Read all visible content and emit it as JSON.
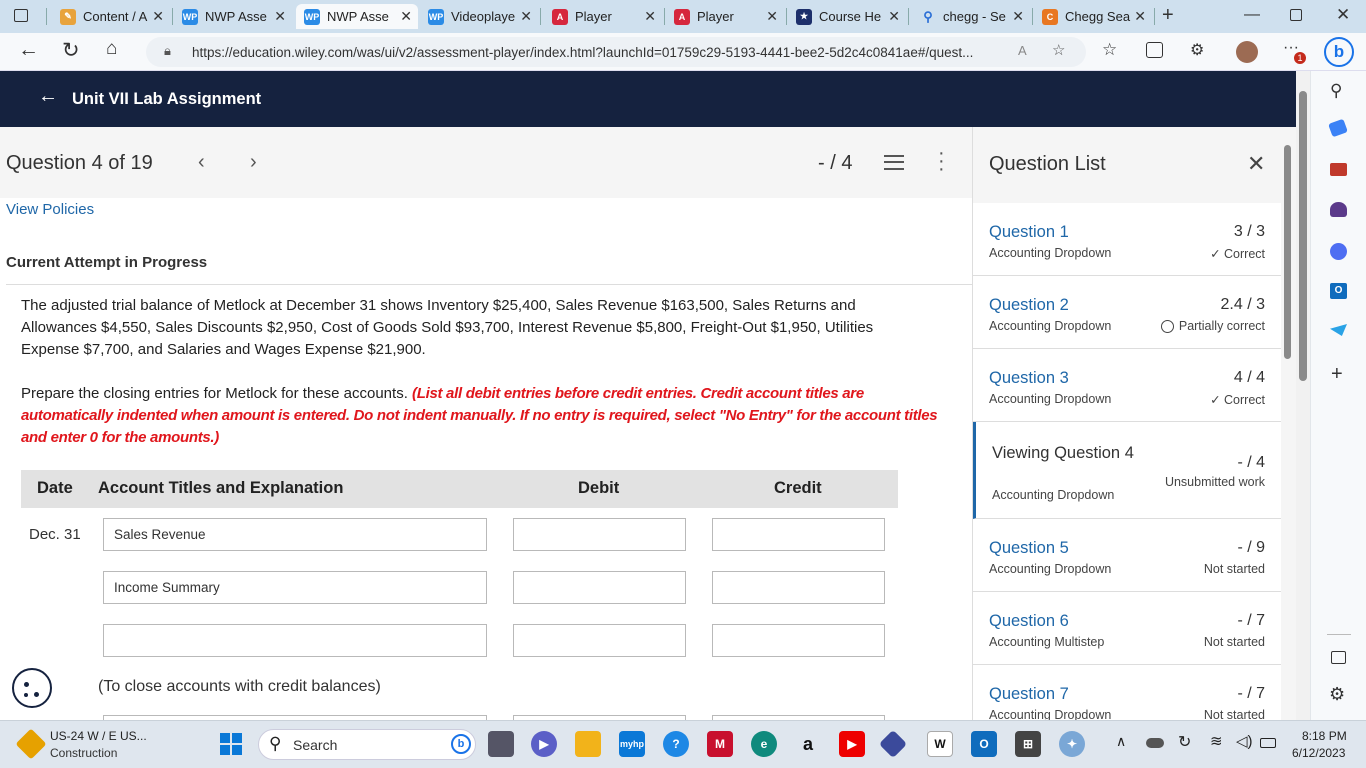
{
  "browser": {
    "tabs": [
      {
        "label": "Content / A",
        "icon": "pencil-icon",
        "color": "#e8a33c"
      },
      {
        "label": "NWP Asse",
        "icon": "wp-icon",
        "color": "#2b8be6"
      },
      {
        "label": "NWP Asse",
        "icon": "wp-icon",
        "color": "#2b8be6",
        "active": true
      },
      {
        "label": "Videoplaye",
        "icon": "wp-icon",
        "color": "#2b8be6"
      },
      {
        "label": "Player",
        "icon": "angular-icon",
        "color": "#d6273d"
      },
      {
        "label": "Player",
        "icon": "angular-icon",
        "color": "#d6273d"
      },
      {
        "label": "Course He",
        "icon": "star-icon",
        "color": "#1d2f6b"
      },
      {
        "label": "chegg - Se",
        "icon": "search-icon",
        "color": "#2b6fd6"
      },
      {
        "label": "Chegg Sea",
        "icon": "chegg-icon",
        "color": "#e87722"
      }
    ],
    "url": "https://education.wiley.com/was/ui/v2/assessment-player/index.html?launchId=01759c29-5193-4441-bee2-5d2c4c0841ae#/quest...",
    "notif_badge": "1"
  },
  "app": {
    "back_title": "Unit VII Lab Assignment",
    "question_nav": {
      "label": "Question 4 of 19",
      "score": "- / 4"
    },
    "view_policies": "View Policies",
    "attempt_status": "Current Attempt in Progress",
    "problem_text": "The adjusted trial balance of Metlock at December 31 shows Inventory $25,400, Sales Revenue $163,500, Sales Returns and Allowances $4,550, Sales Discounts $2,950, Cost of Goods Sold $93,700, Interest Revenue $5,800, Freight-Out $1,950, Utilities Expense $7,700, and Salaries and Wages Expense $21,900.",
    "instruction_lead": "Prepare the closing entries for Metlock for these accounts.",
    "instruction_red": "(List all debit entries before credit entries. Credit account titles are automatically indented when amount is entered. Do not indent manually. If no entry is required, select \"No Entry\" for the account titles and enter 0 for the amounts.)",
    "table": {
      "headers": [
        "Date",
        "Account Titles and Explanation",
        "Debit",
        "Credit"
      ],
      "date": "Dec. 31",
      "rows": [
        {
          "account": "Sales Revenue",
          "debit": "",
          "credit": ""
        },
        {
          "account": "Income Summary",
          "debit": "",
          "credit": ""
        },
        {
          "account": "",
          "debit": "",
          "credit": ""
        }
      ],
      "explanation": "(To close accounts with credit balances)"
    }
  },
  "question_list": {
    "title": "Question List",
    "items": [
      {
        "title": "Question 1",
        "type": "Accounting Dropdown",
        "score": "3 / 3",
        "status": "✓ Correct"
      },
      {
        "title": "Question 2",
        "type": "Accounting Dropdown",
        "score": "2.4 / 3",
        "status": "Partially correct"
      },
      {
        "title": "Question 3",
        "type": "Accounting Dropdown",
        "score": "4 / 4",
        "status": "✓ Correct"
      },
      {
        "title": "Viewing Question 4",
        "type": "Accounting Dropdown",
        "score": "- / 4",
        "status": "Unsubmitted work",
        "current": true
      },
      {
        "title": "Question 5",
        "type": "Accounting Dropdown",
        "score": "- / 9",
        "status": "Not started"
      },
      {
        "title": "Question 6",
        "type": "Accounting Multistep",
        "score": "- / 7",
        "status": "Not started"
      },
      {
        "title": "Question 7",
        "type": "Accounting Dropdown",
        "score": "- / 7",
        "status": "Not started"
      }
    ]
  },
  "taskbar": {
    "weather_title": "US-24 W / E US...",
    "weather_sub": "Construction",
    "search_placeholder": "Search",
    "time": "8:18 PM",
    "date": "6/12/2023"
  },
  "colors": {
    "header_bg": "#15223f",
    "link": "#1f67a8",
    "instruction_red": "#e0161c"
  }
}
